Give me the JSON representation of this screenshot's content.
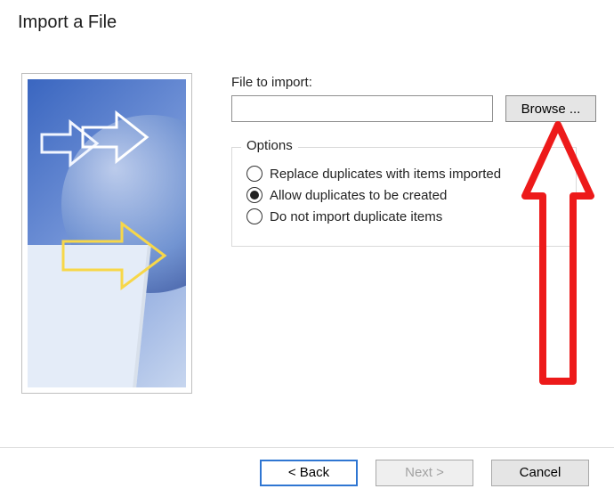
{
  "title": "Import a File",
  "file": {
    "label": "File to import:",
    "value": "",
    "placeholder": "",
    "browse_label": "Browse ..."
  },
  "options": {
    "legend": "Options",
    "selected_index": 1,
    "items": [
      "Replace duplicates with items imported",
      "Allow duplicates to be created",
      "Do not import duplicate items"
    ]
  },
  "footer": {
    "back_label": "<  Back",
    "next_label": "Next  >",
    "cancel_label": "Cancel",
    "next_enabled": false
  }
}
